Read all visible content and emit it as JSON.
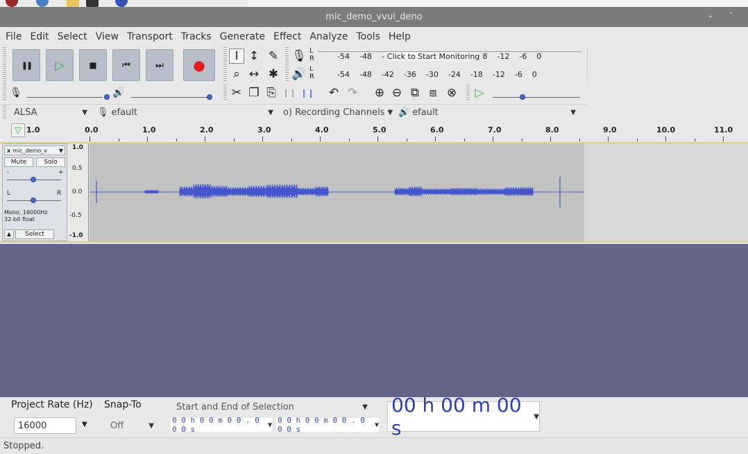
{
  "window": {
    "title": "mic_demo_vvui_deno",
    "controls": "⌄ ˄"
  },
  "menu": [
    "File",
    "Edit",
    "Select",
    "View",
    "Transport",
    "Tracks",
    "Generate",
    "Effect",
    "Analyze",
    "Tools",
    "Help"
  ],
  "transport": {
    "pause_icon": "❚❚",
    "play_icon": "▷",
    "stop_icon": "■",
    "skip_start_icon": "⏮",
    "skip_end_icon": "⏭",
    "record_icon": "●"
  },
  "meters": {
    "record_scale": [
      "-54",
      "-48",
      "- Click to Start Monitoring",
      " -12",
      "-6",
      "0"
    ],
    "record_prefix": [
      "-54",
      "-48"
    ],
    "record_click": "Click to Start Monitoring",
    "record_suffix_partial": "8",
    "record_tail": [
      "-12",
      "-6",
      "0"
    ],
    "playback_scale": [
      "-54",
      "-48",
      "-42",
      "-36",
      "-30",
      "-24",
      "-18",
      "-12",
      "-6",
      "0"
    ],
    "channel_l": "L",
    "channel_r": "R"
  },
  "device": {
    "host": "ALSA",
    "recording_device": "efault",
    "recording_channels": "o) Recording Channels",
    "playback_device": "efault"
  },
  "ruler": {
    "start_label": "1.0",
    "labels": [
      "0.0",
      "1.0",
      "2.0",
      "3.0",
      "4.0",
      "5.0",
      "6.0",
      "7.0",
      "8.0",
      "9.0",
      "10.0",
      "11.0"
    ]
  },
  "track": {
    "close": "x",
    "name": "mic_demo_v",
    "mute": "Mute",
    "solo": "Solo",
    "gain_minus": "-",
    "gain_plus": "+",
    "pan_l": "L",
    "pan_r": "R",
    "info_line1": "Mono, 16000Hz",
    "info_line2": "32-bit float",
    "select": "Select",
    "collapse": "▲",
    "scale": [
      "1.0",
      "0.5",
      "0.0",
      "-0.5",
      "-1.0"
    ]
  },
  "bottom": {
    "project_rate_label": "Project Rate (Hz)",
    "snap_to_label": "Snap-To",
    "project_rate_value": "16000",
    "snap_to_value": "Off",
    "selection_mode": "Start and End of Selection",
    "sel_start": "0 0 h 0 0 m 0 0 . 0 0 0 s",
    "sel_end": "0 0 h 0 0 m 0 0 . 0 0 0 s",
    "audio_position": "00 h 00 m 00 s"
  },
  "status": "Stopped.",
  "colors": {
    "waveform": "#4455cc",
    "background_empty": "#646488",
    "track_selected_border": "#d5d08a",
    "record": "#e02020",
    "play": "#39b54a"
  }
}
